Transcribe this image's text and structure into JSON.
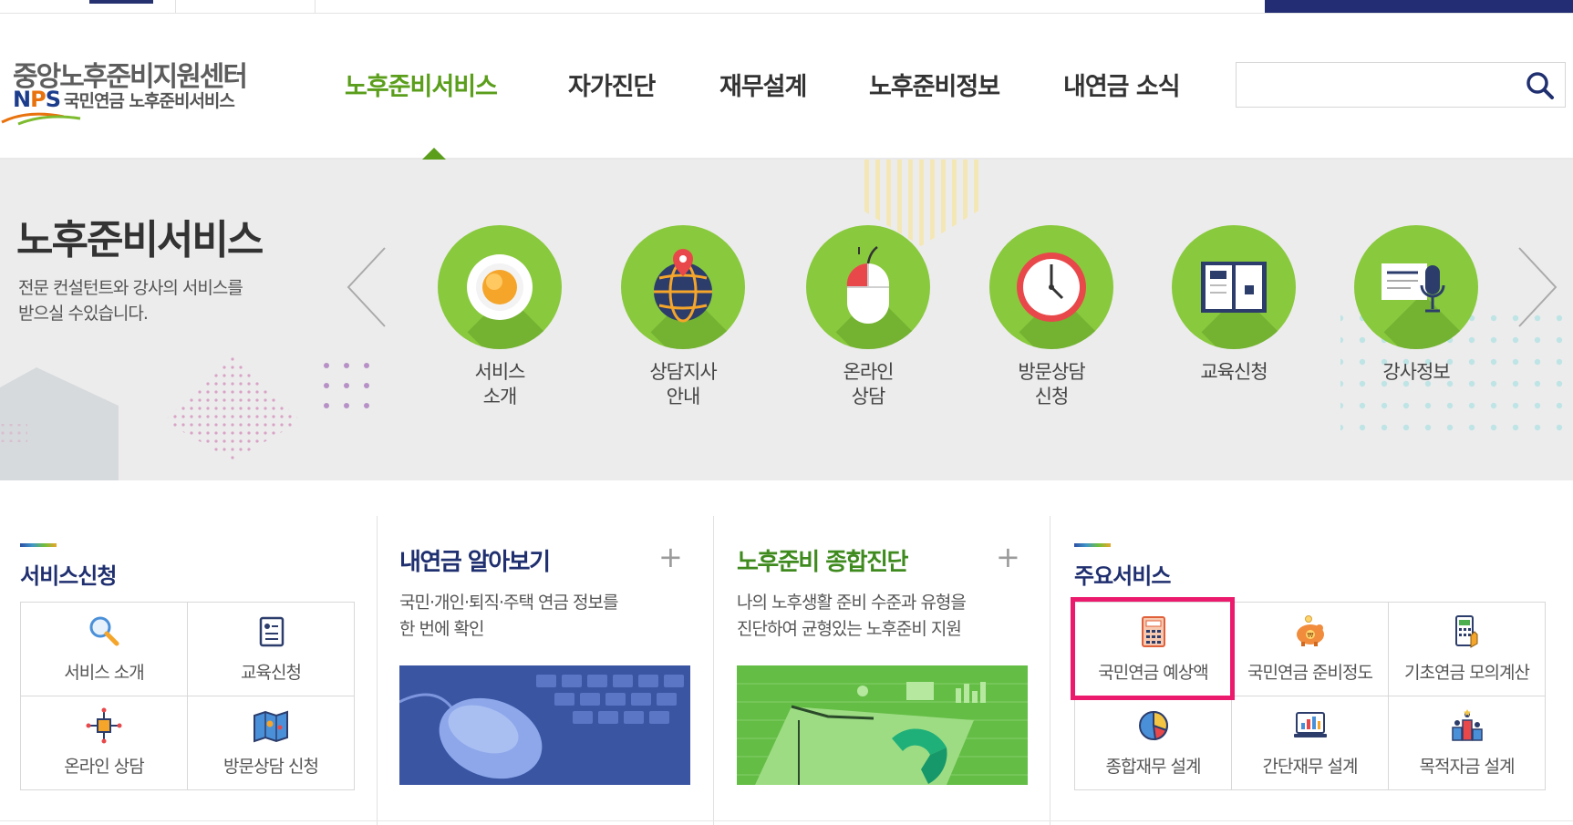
{
  "header": {
    "logo_main": "중앙노후준비지원센터",
    "logo_nps_n": "N",
    "logo_nps_p": "P",
    "logo_nps_s": "S",
    "logo_sub": "국민연금 노후준비서비스",
    "nav": [
      "노후준비서비스",
      "자가진단",
      "재무설계",
      "노후준비정보",
      "내연금 소식"
    ],
    "active_nav": "노후준비서비스",
    "search_value": ""
  },
  "banner": {
    "title": "노후준비서비스",
    "desc_line1": "전문 컨설턴트와 강사의 서비스를",
    "desc_line2": "받으실 수있습니다.",
    "items": [
      {
        "line1": "서비스",
        "line2": "소개",
        "icon": "coffee-cup-icon"
      },
      {
        "line1": "상담지사",
        "line2": "안내",
        "icon": "globe-pin-icon"
      },
      {
        "line1": "온라인",
        "line2": "상담",
        "icon": "mouse-icon"
      },
      {
        "line1": "방문상담",
        "line2": "신청",
        "icon": "clock-icon"
      },
      {
        "line1": "교육신청",
        "line2": "",
        "icon": "open-book-icon"
      },
      {
        "line1": "강사정보",
        "line2": "",
        "icon": "microphone-icon"
      }
    ],
    "accent_color": "#89c93d"
  },
  "service_apply": {
    "title": "서비스신청",
    "items": [
      "서비스 소개",
      "교육신청",
      "온라인 상담",
      "방문상담 신청"
    ]
  },
  "my_pension": {
    "title": "내연금 알아보기",
    "plus": "+",
    "desc_line1": "국민·개인·퇴직·주택 연금 정보를",
    "desc_line2": "한 번에 확인"
  },
  "retire_diag": {
    "title": "노후준비 종합진단",
    "plus": "+",
    "desc_line1": "나의 노후생활 준비 수준과 유형을",
    "desc_line2": "진단하여 균형있는 노후준비 지원"
  },
  "main_services": {
    "title": "주요서비스",
    "items": [
      "국민연금 예상액",
      "국민연금 준비정도",
      "기초연금 모의계산",
      "종합재무 설계",
      "간단재무 설계",
      "목적자금 설계"
    ],
    "highlighted": "국민연금 예상액",
    "highlight_color": "#ec1a6d"
  }
}
